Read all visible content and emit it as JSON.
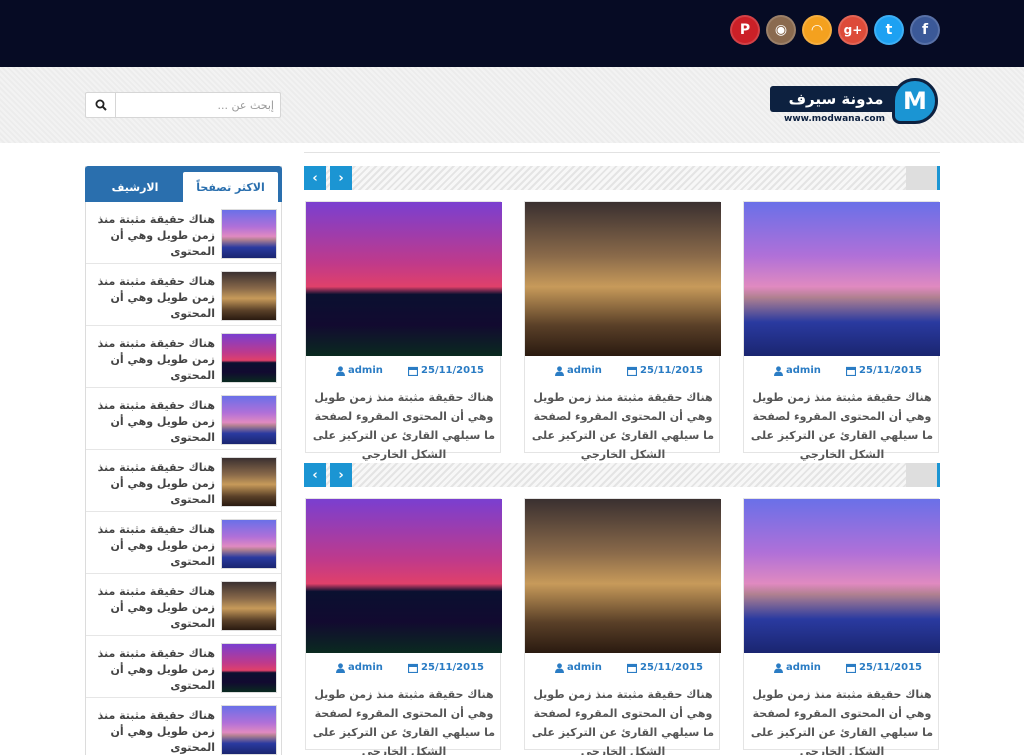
{
  "colors": {
    "topbar": "#060b24",
    "accent": "#1b95d3",
    "tab_blue": "#2a6fae",
    "meta": "#2a7cc4"
  },
  "social": [
    {
      "name": "pinterest",
      "glyph": "P",
      "color": "#cb2027"
    },
    {
      "name": "instagram",
      "glyph": "◉",
      "color": "#8a6a4f"
    },
    {
      "name": "rss",
      "glyph": "◠",
      "color": "#f4a11f"
    },
    {
      "name": "google-plus",
      "glyph": "g+",
      "color": "#dd4b39"
    },
    {
      "name": "twitter",
      "glyph": "t",
      "color": "#1da1f2"
    },
    {
      "name": "facebook",
      "glyph": "f",
      "color": "#3b5998"
    }
  ],
  "logo": {
    "title": "مدونة سيرف",
    "letter": "M",
    "url": "www.modwana.com"
  },
  "search": {
    "placeholder": "إبحث عن ..."
  },
  "sidebar": {
    "tabs": {
      "active": "الاكثر تصفحاً",
      "inactive": "الارشيف"
    },
    "items": [
      {
        "title": "هناك حقيقة مثبتة منذ زمن طويل وهي أن المحتوى"
      },
      {
        "title": "هناك حقيقة مثبتة منذ زمن طويل وهي أن المحتوى"
      },
      {
        "title": "هناك حقيقة مثبتة منذ زمن طويل وهي أن المحتوى"
      },
      {
        "title": "هناك حقيقة مثبتة منذ زمن طويل وهي أن المحتوى"
      },
      {
        "title": "هناك حقيقة مثبتة منذ زمن طويل وهي أن المحتوى"
      },
      {
        "title": "هناك حقيقة مثبتة منذ زمن طويل وهي أن المحتوى"
      },
      {
        "title": "هناك حقيقة مثبتة منذ زمن طويل وهي أن المحتوى"
      },
      {
        "title": "هناك حقيقة مثبتة منذ زمن طويل وهي أن المحتوى"
      },
      {
        "title": "هناك حقيقة مثبتة منذ زمن طويل وهي أن المحتوى"
      }
    ]
  },
  "sliders": [
    {
      "cards": [
        {
          "date": "25/11/2015",
          "author": "admin",
          "excerpt": "هناك حقيقة مثبتة منذ زمن طويل وهي أن المحتوى المقروء لصفحة ما سيلهي القارئ عن التركيز على الشكل الخارجي"
        },
        {
          "date": "25/11/2015",
          "author": "admin",
          "excerpt": "هناك حقيقة مثبتة منذ زمن طويل وهي أن المحتوى المقروء لصفحة ما سيلهي القارئ عن التركيز على الشكل الخارجي"
        },
        {
          "date": "25/11/2015",
          "author": "admin",
          "excerpt": "هناك حقيقة مثبتة منذ زمن طويل وهي أن المحتوى المقروء لصفحة ما سيلهي القارئ عن التركيز على الشكل الخارجي"
        }
      ]
    },
    {
      "cards": [
        {
          "date": "25/11/2015",
          "author": "admin",
          "excerpt": "هناك حقيقة مثبتة منذ زمن طويل وهي أن المحتوى المقروء لصفحة ما سيلهي القارئ عن التركيز على الشكل الخارجي"
        },
        {
          "date": "25/11/2015",
          "author": "admin",
          "excerpt": "هناك حقيقة مثبتة منذ زمن طويل وهي أن المحتوى المقروء لصفحة ما سيلهي القارئ عن التركيز على الشكل الخارجي"
        },
        {
          "date": "25/11/2015",
          "author": "admin",
          "excerpt": "هناك حقيقة مثبتة منذ زمن طويل وهي أن المحتوى المقروء لصفحة ما سيلهي القارئ عن التركيز على الشكل الخارجي"
        }
      ]
    }
  ],
  "nav": {
    "prev": "‹",
    "next": "›"
  }
}
